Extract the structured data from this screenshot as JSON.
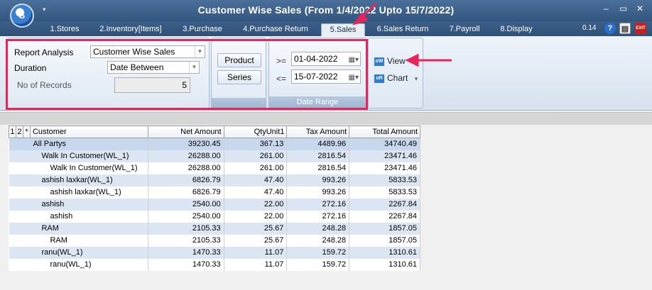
{
  "window": {
    "title": "Customer Wise Sales (From 1/4/2022 Upto 15/7/2022)",
    "logo_text": "S",
    "quick_access": "▾",
    "min_label": "–",
    "max_label": "▭",
    "close_label": "✕",
    "version": "0.14"
  },
  "tabs": [
    {
      "label": "1.Stores"
    },
    {
      "label": "2.Inventory[Items]"
    },
    {
      "label": "3.Purchase"
    },
    {
      "label": "4.Purchase Return"
    },
    {
      "label": "5.Sales"
    },
    {
      "label": "6.Sales Return"
    },
    {
      "label": "7.Payroll"
    },
    {
      "label": "8.Display"
    }
  ],
  "header_icons": {
    "help": "?",
    "doc": "▤",
    "exit": "EXIT"
  },
  "report_group": {
    "report_analysis_label": "Report Analysis",
    "report_analysis_value": "Customer Wise Sales",
    "duration_label": "Duration",
    "duration_value": "Date Between",
    "records_label": "No of Records",
    "records_value": "5"
  },
  "buttons": {
    "product": "Product",
    "series": "Series"
  },
  "date_range": {
    "from_op": ">=",
    "from_value": "01-04-2022",
    "to_op": "<=",
    "to_value": "15-07-2022",
    "caption": "Date Range"
  },
  "actions": {
    "view": "View",
    "chart": "Chart",
    "chart_arrow": "▾"
  },
  "grid": {
    "col_level1": "1",
    "col_level2": "2",
    "col_star": "*",
    "columns": [
      "Customer",
      "Net Amount",
      "QtyUnit1",
      "Tax Amount",
      "Total Amount"
    ],
    "rows": [
      {
        "customer": "All Partys",
        "net": "39230.45",
        "qty": "367.13",
        "tax": "4489.96",
        "total": "34740.49",
        "indent": 0
      },
      {
        "customer": "Walk In Customer(WL_1)",
        "net": "26288.00",
        "qty": "261.00",
        "tax": "2816.54",
        "total": "23471.46",
        "indent": 1
      },
      {
        "customer": "Walk In Customer(WL_1)",
        "net": "26288.00",
        "qty": "261.00",
        "tax": "2816.54",
        "total": "23471.46",
        "indent": 2
      },
      {
        "customer": "ashish laxkar(WL_1)",
        "net": "6826.79",
        "qty": "47.40",
        "tax": "993.26",
        "total": "5833.53",
        "indent": 1
      },
      {
        "customer": "ashish laxkar(WL_1)",
        "net": "6826.79",
        "qty": "47.40",
        "tax": "993.26",
        "total": "5833.53",
        "indent": 2
      },
      {
        "customer": "ashish",
        "net": "2540.00",
        "qty": "22.00",
        "tax": "272.16",
        "total": "2267.84",
        "indent": 1
      },
      {
        "customer": "ashish",
        "net": "2540.00",
        "qty": "22.00",
        "tax": "272.16",
        "total": "2267.84",
        "indent": 2
      },
      {
        "customer": "RAM",
        "net": "2105.33",
        "qty": "25.67",
        "tax": "248.28",
        "total": "1857.05",
        "indent": 1
      },
      {
        "customer": "RAM",
        "net": "2105.33",
        "qty": "25.67",
        "tax": "248.28",
        "total": "1857.05",
        "indent": 2
      },
      {
        "customer": "ranu(WL_1)",
        "net": "1470.33",
        "qty": "11.07",
        "tax": "159.72",
        "total": "1310.61",
        "indent": 1
      },
      {
        "customer": "ranu(WL_1)",
        "net": "1470.33",
        "qty": "11.07",
        "tax": "159.72",
        "total": "1310.61",
        "indent": 2
      }
    ]
  },
  "colors": {
    "highlight": "#e8245a",
    "titlebar": "#33567f",
    "row_band": "#dce6f2"
  }
}
